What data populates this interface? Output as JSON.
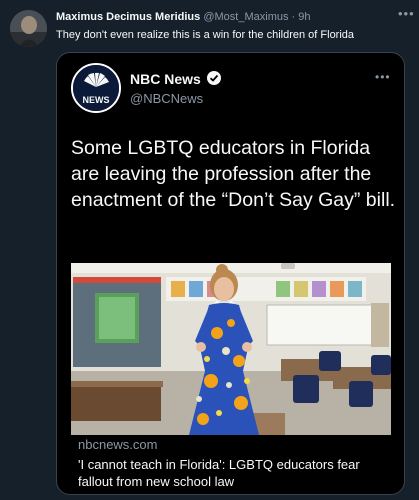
{
  "tweet": {
    "author_name": "Maximus Decimus Meridius",
    "handle": "@Most_Maximus",
    "separator": "·",
    "time": "9h",
    "text": "They don't even realize this is a win for the children of Florida",
    "more_icon": "more-horizontal-icon"
  },
  "quoted": {
    "account_name": "NBC News",
    "handle": "@NBCNews",
    "verified_icon": "verified-badge-icon",
    "logo_word": "NEWS",
    "text": "Some LGBTQ educators in Florida are leaving the profession after the enactment of the “Don’t Say Gay” bill.",
    "link_card": {
      "domain": "nbcnews.com",
      "title": "'I cannot teach in Florida': LGBTQ educators fear fallout from new school law"
    }
  },
  "colors": {
    "background": "#15202b",
    "card_background": "#000000",
    "border": "#38444d",
    "muted_text": "#8b98a5",
    "primary_text": "#f7f9f9"
  }
}
